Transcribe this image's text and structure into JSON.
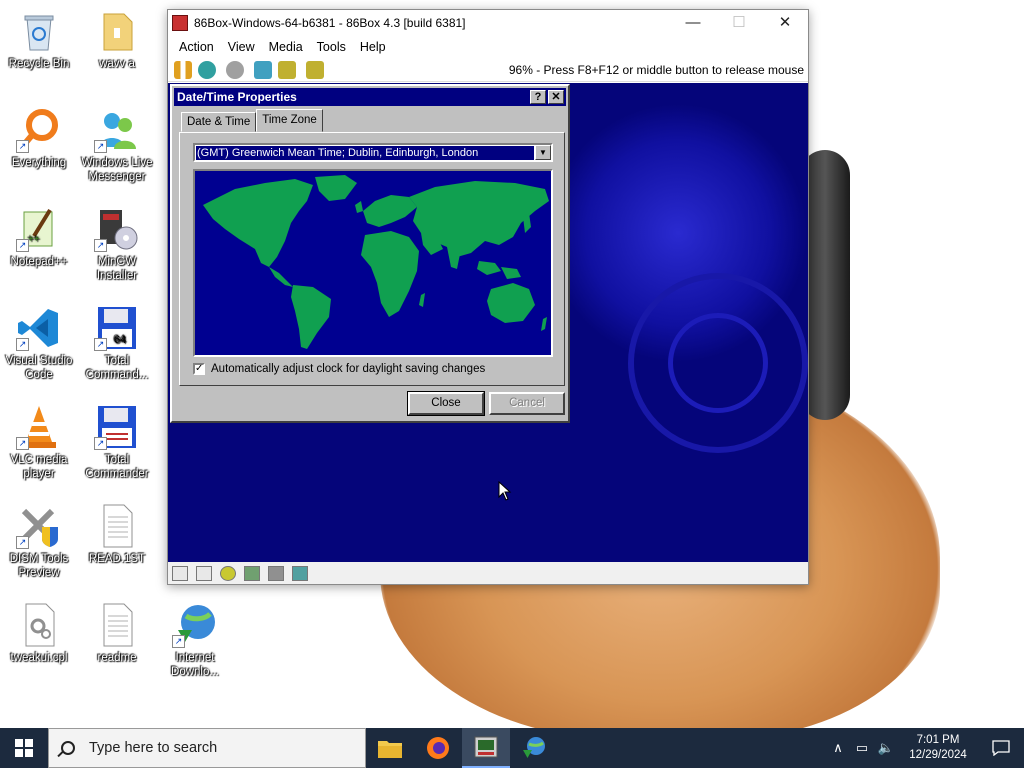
{
  "desktop": {
    "icons": [
      {
        "label": "Recycle Bin",
        "icon": "recycle-bin-icon"
      },
      {
        "label": "wavv a",
        "icon": "folder-icon"
      },
      {
        "label": "Everything",
        "icon": "everything-search-icon"
      },
      {
        "label": "Windows Live Messenger",
        "icon": "messenger-icon"
      },
      {
        "label": "Notepad++",
        "icon": "notepad-plus-plus-icon"
      },
      {
        "label": "MinGW Installer",
        "icon": "mingw-installer-icon"
      },
      {
        "label": "Visual Studio Code",
        "icon": "vscode-icon"
      },
      {
        "label": "Total Command...",
        "icon": "floppy-64-icon"
      },
      {
        "label": "VLC media player",
        "icon": "vlc-icon"
      },
      {
        "label": "Total Commander",
        "icon": "floppy-icon"
      },
      {
        "label": "DISM Tools Preview",
        "icon": "dism-tools-icon"
      },
      {
        "label": "READ.1ST",
        "icon": "text-file-icon"
      },
      {
        "label": "tweakui.cpl",
        "icon": "cpl-file-icon"
      },
      {
        "label": "readme",
        "icon": "text-file-icon"
      },
      {
        "label": "Internet Downlo...",
        "icon": "internet-download-manager-icon"
      }
    ]
  },
  "window": {
    "title": "86Box-Windows-64-b6381 - 86Box 4.3 [build 6381]",
    "controls": {
      "minimize": "—",
      "maximize": "☐",
      "close": "✕"
    },
    "menu": [
      "Action",
      "View",
      "Media",
      "Tools",
      "Help"
    ],
    "toolbar_message": "96% - Press F8+F12 or middle button to release mouse",
    "toolbar_icons": [
      "pause-icon",
      "reset-icon",
      "power-icon",
      "ctrl-alt-del-icon",
      "ctrl-alt-esc-icon",
      "settings-icon"
    ],
    "status_icons": [
      "floppy-drive-icon",
      "floppy-drive-icon",
      "cdrom-icon",
      "network-icon",
      "hdd-icon",
      "sound-icon"
    ]
  },
  "dialog": {
    "title": "Date/Time Properties",
    "help_label": "?",
    "close_label": "✕",
    "tabs": [
      "Date & Time",
      "Time Zone"
    ],
    "active_tab": "Time Zone",
    "timezone": "(GMT) Greenwich Mean Time; Dublin, Edinburgh, London",
    "dst_checkbox_label": "Automatically adjust clock for daylight saving changes",
    "dst_checked": true,
    "close_button": "Close",
    "cancel_button": "Cancel",
    "colors": {
      "map_ocean": "#000090",
      "map_land": "#10a050",
      "title_bar": "#000080"
    }
  },
  "taskbar": {
    "search_placeholder": "Type here to search",
    "pinned": [
      "file-explorer-icon",
      "firefox-icon",
      "86box-icon",
      "internet-download-manager-icon"
    ],
    "active_app": "86box-icon",
    "tray_icons": [
      "chevron-up-icon",
      "network-icon",
      "volume-muted-icon"
    ],
    "time": "7:01 PM",
    "date": "12/29/2024"
  }
}
